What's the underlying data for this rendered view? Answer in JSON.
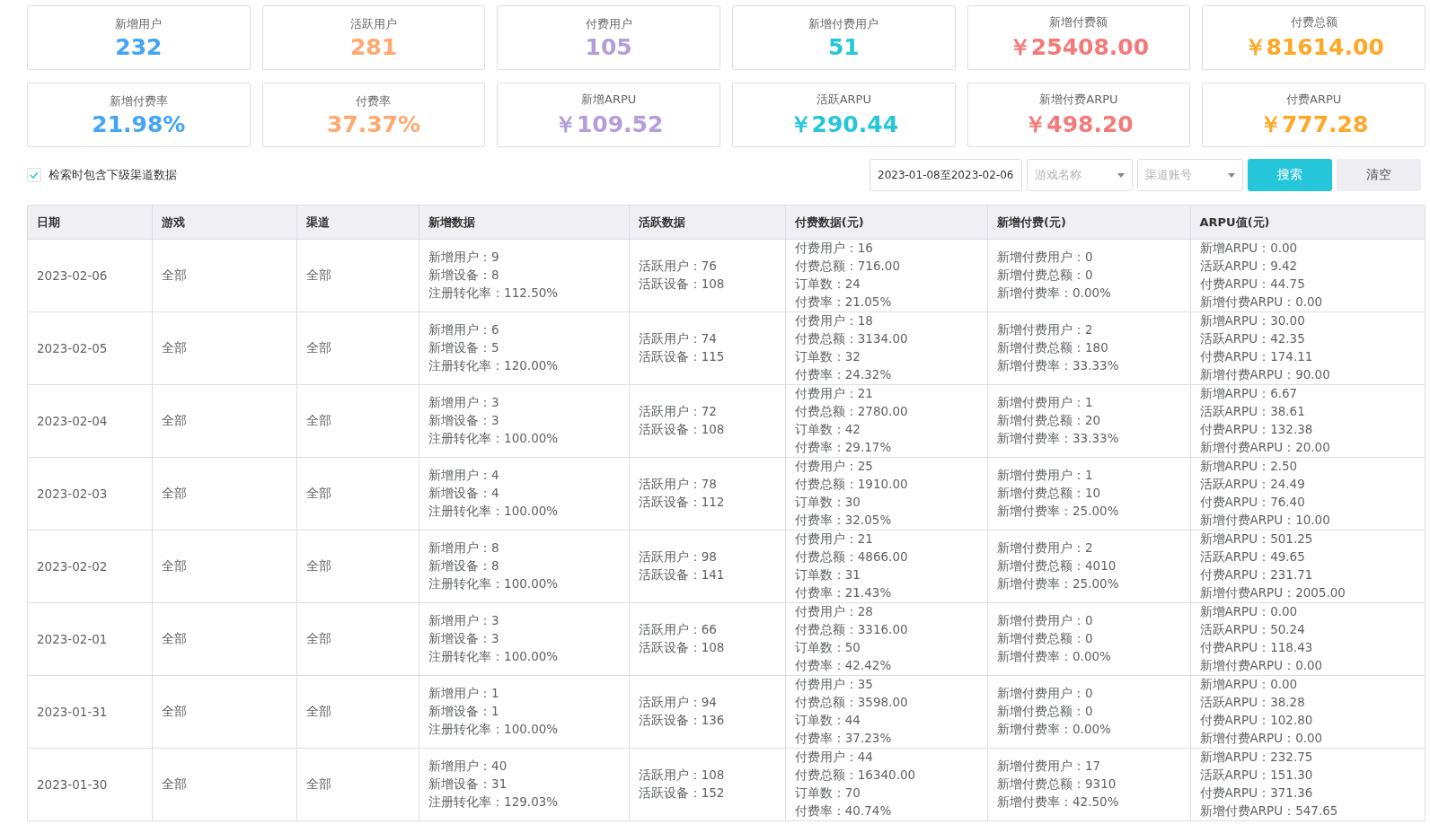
{
  "stats": [
    {
      "label": "新增用户",
      "value": "232",
      "color": "#42a5f5"
    },
    {
      "label": "活跃用户",
      "value": "281",
      "color": "#ffa970"
    },
    {
      "label": "付费用户",
      "value": "105",
      "color": "#b39ddb"
    },
    {
      "label": "新增付费用户",
      "value": "51",
      "color": "#26c6da"
    },
    {
      "label": "新增付费额",
      "value": "￥25408.00",
      "color": "#f47a7a"
    },
    {
      "label": "付费总额",
      "value": "￥81614.00",
      "color": "#ffa726"
    },
    {
      "label": "新增付费率",
      "value": "21.98%",
      "color": "#42a5f5"
    },
    {
      "label": "付费率",
      "value": "37.37%",
      "color": "#ffa970"
    },
    {
      "label": "新增ARPU",
      "value": "￥109.52",
      "color": "#b39ddb"
    },
    {
      "label": "活跃ARPU",
      "value": "￥290.44",
      "color": "#26c6da"
    },
    {
      "label": "新增付费ARPU",
      "value": "￥498.20",
      "color": "#f47a7a"
    },
    {
      "label": "付费ARPU",
      "value": "￥777.28",
      "color": "#ffa726"
    }
  ],
  "filters": {
    "include_sub_channels": {
      "label": "检索时包含下级渠道数据",
      "checked": true
    },
    "date_range": "2023-01-08至2023-02-06",
    "game": {
      "placeholder": "游戏名称"
    },
    "channel": {
      "placeholder": "渠道账号"
    },
    "buttons": [
      "搜索",
      "清空"
    ]
  },
  "table": {
    "columns": [
      "日期",
      "游戏",
      "渠道",
      "新增数据",
      "活跃数据",
      "付费数据(元)",
      "新增付费(元)",
      "ARPU值(元)"
    ],
    "rows": [
      {
        "date": "2023-02-06",
        "game": "全部",
        "channel": "全部",
        "new": [
          "新增用户：9",
          "新增设备：8",
          "注册转化率：112.50%"
        ],
        "active": [
          "活跃用户：76",
          "活跃设备：108"
        ],
        "pay": [
          "付费用户：16",
          "付费总额：716.00",
          "订单数：24",
          "付费率：21.05%"
        ],
        "new_pay": [
          "新增付费用户：0",
          "新增付费总额：0",
          "新增付费率：0.00%"
        ],
        "arpu": [
          "新增ARPU：0.00",
          "活跃ARPU：9.42",
          "付费ARPU：44.75",
          "新增付费ARPU：0.00"
        ]
      },
      {
        "date": "2023-02-05",
        "game": "全部",
        "channel": "全部",
        "new": [
          "新增用户：6",
          "新增设备：5",
          "注册转化率：120.00%"
        ],
        "active": [
          "活跃用户：74",
          "活跃设备：115"
        ],
        "pay": [
          "付费用户：18",
          "付费总额：3134.00",
          "订单数：32",
          "付费率：24.32%"
        ],
        "new_pay": [
          "新增付费用户：2",
          "新增付费总额：180",
          "新增付费率：33.33%"
        ],
        "arpu": [
          "新增ARPU：30.00",
          "活跃ARPU：42.35",
          "付费ARPU：174.11",
          "新增付费ARPU：90.00"
        ]
      },
      {
        "date": "2023-02-04",
        "game": "全部",
        "channel": "全部",
        "new": [
          "新增用户：3",
          "新增设备：3",
          "注册转化率：100.00%"
        ],
        "active": [
          "活跃用户：72",
          "活跃设备：108"
        ],
        "pay": [
          "付费用户：21",
          "付费总额：2780.00",
          "订单数：42",
          "付费率：29.17%"
        ],
        "new_pay": [
          "新增付费用户：1",
          "新增付费总额：20",
          "新增付费率：33.33%"
        ],
        "arpu": [
          "新增ARPU：6.67",
          "活跃ARPU：38.61",
          "付费ARPU：132.38",
          "新增付费ARPU：20.00"
        ]
      },
      {
        "date": "2023-02-03",
        "game": "全部",
        "channel": "全部",
        "new": [
          "新增用户：4",
          "新增设备：4",
          "注册转化率：100.00%"
        ],
        "active": [
          "活跃用户：78",
          "活跃设备：112"
        ],
        "pay": [
          "付费用户：25",
          "付费总额：1910.00",
          "订单数：30",
          "付费率：32.05%"
        ],
        "new_pay": [
          "新增付费用户：1",
          "新增付费总额：10",
          "新增付费率：25.00%"
        ],
        "arpu": [
          "新增ARPU：2.50",
          "活跃ARPU：24.49",
          "付费ARPU：76.40",
          "新增付费ARPU：10.00"
        ]
      },
      {
        "date": "2023-02-02",
        "game": "全部",
        "channel": "全部",
        "new": [
          "新增用户：8",
          "新增设备：8",
          "注册转化率：100.00%"
        ],
        "active": [
          "活跃用户：98",
          "活跃设备：141"
        ],
        "pay": [
          "付费用户：21",
          "付费总额：4866.00",
          "订单数：31",
          "付费率：21.43%"
        ],
        "new_pay": [
          "新增付费用户：2",
          "新增付费总额：4010",
          "新增付费率：25.00%"
        ],
        "arpu": [
          "新增ARPU：501.25",
          "活跃ARPU：49.65",
          "付费ARPU：231.71",
          "新增付费ARPU：2005.00"
        ]
      },
      {
        "date": "2023-02-01",
        "game": "全部",
        "channel": "全部",
        "new": [
          "新增用户：3",
          "新增设备：3",
          "注册转化率：100.00%"
        ],
        "active": [
          "活跃用户：66",
          "活跃设备：108"
        ],
        "pay": [
          "付费用户：28",
          "付费总额：3316.00",
          "订单数：50",
          "付费率：42.42%"
        ],
        "new_pay": [
          "新增付费用户：0",
          "新增付费总额：0",
          "新增付费率：0.00%"
        ],
        "arpu": [
          "新增ARPU：0.00",
          "活跃ARPU：50.24",
          "付费ARPU：118.43",
          "新增付费ARPU：0.00"
        ]
      },
      {
        "date": "2023-01-31",
        "game": "全部",
        "channel": "全部",
        "new": [
          "新增用户：1",
          "新增设备：1",
          "注册转化率：100.00%"
        ],
        "active": [
          "活跃用户：94",
          "活跃设备：136"
        ],
        "pay": [
          "付费用户：35",
          "付费总额：3598.00",
          "订单数：44",
          "付费率：37.23%"
        ],
        "new_pay": [
          "新增付费用户：0",
          "新增付费总额：0",
          "新增付费率：0.00%"
        ],
        "arpu": [
          "新增ARPU：0.00",
          "活跃ARPU：38.28",
          "付费ARPU：102.80",
          "新增付费ARPU：0.00"
        ]
      },
      {
        "date": "2023-01-30",
        "game": "全部",
        "channel": "全部",
        "new": [
          "新增用户：40",
          "新增设备：31",
          "注册转化率：129.03%"
        ],
        "active": [
          "活跃用户：108",
          "活跃设备：152"
        ],
        "pay": [
          "付费用户：44",
          "付费总额：16340.00",
          "订单数：70",
          "付费率：40.74%"
        ],
        "new_pay": [
          "新增付费用户：17",
          "新增付费总额：9310",
          "新增付费率：42.50%"
        ],
        "arpu": [
          "新增ARPU：232.75",
          "活跃ARPU：151.30",
          "付费ARPU：371.36",
          "新增付费ARPU：547.65"
        ]
      }
    ]
  }
}
